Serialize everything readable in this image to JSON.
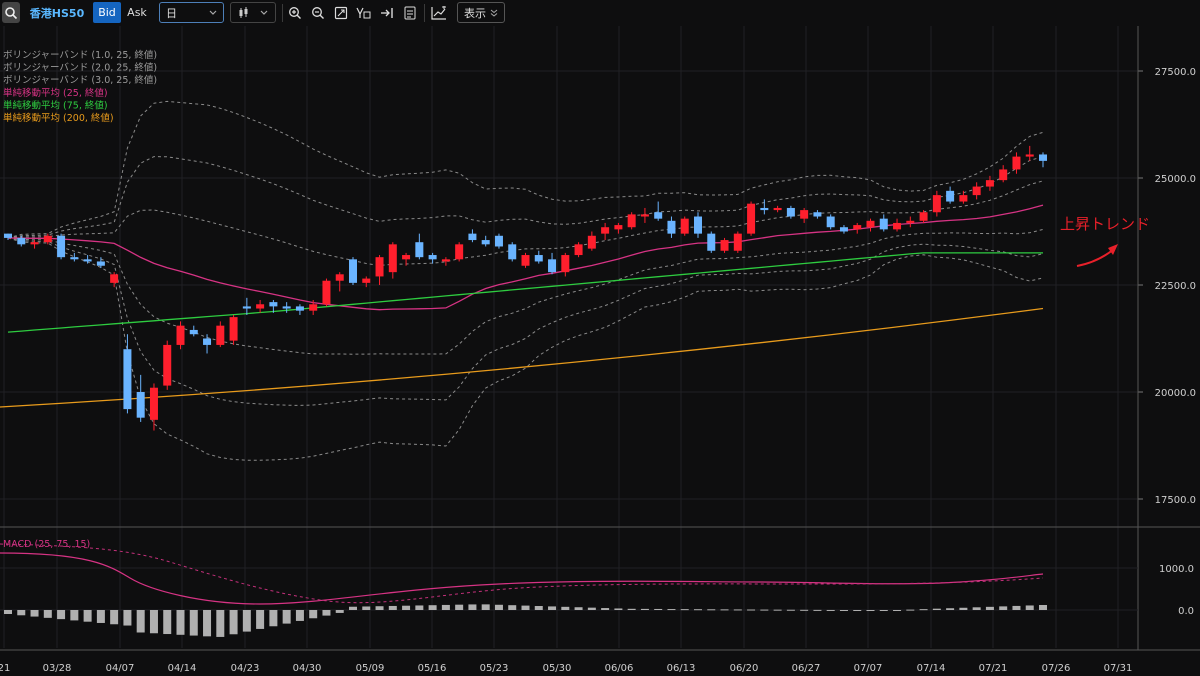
{
  "toolbar": {
    "symbol": "香港HS50",
    "bid": "Bid",
    "ask": "Ask",
    "timeframe": "日",
    "display": "表示",
    "accent": "#1565c0"
  },
  "legend": [
    {
      "label": "ボリンジャーバンド (1.0, 25, 終値)",
      "color": "#9a9a9a"
    },
    {
      "label": "ボリンジャーバンド (2.0, 25, 終値)",
      "color": "#9a9a9a"
    },
    {
      "label": "ボリンジャーバンド (3.0, 25, 終値)",
      "color": "#9a9a9a"
    },
    {
      "label": "単純移動平均 (25, 終値)",
      "color": "#d63384"
    },
    {
      "label": "単純移動平均 (75, 終値)",
      "color": "#2ecc40"
    },
    {
      "label": "単純移動平均 (200, 終値)",
      "color": "#e89b1c"
    }
  ],
  "annotation": {
    "text": "上昇トレンド",
    "color": "#e8202a"
  },
  "macd_label": "MACD (25, 75, 15)",
  "chart_data": {
    "type": "candlestick",
    "y_ticks": [
      "27500.0",
      "25000.0",
      "22500.0",
      "20000.0",
      "17500.0"
    ],
    "y_tick_values": [
      27500,
      25000,
      22500,
      20000,
      17500
    ],
    "ylim": [
      16900,
      28200
    ],
    "x_tick_labels": [
      "21",
      "03/28",
      "04/07",
      "04/14",
      "04/23",
      "04/30",
      "05/09",
      "05/16",
      "05/23",
      "05/30",
      "06/06",
      "06/13",
      "06/20",
      "06/27",
      "07/07",
      "07/14",
      "07/21",
      "07/26",
      "07/31"
    ],
    "up_color": "#ff1f2d",
    "down_color": "#6ab4ff",
    "candles": [
      [
        23700,
        23700,
        23550,
        23600
      ],
      [
        23600,
        23650,
        23400,
        23450
      ],
      [
        23450,
        23550,
        23350,
        23500
      ],
      [
        23500,
        23700,
        23450,
        23650
      ],
      [
        23650,
        23700,
        23100,
        23150
      ],
      [
        23150,
        23250,
        23050,
        23100
      ],
      [
        23100,
        23200,
        23000,
        23050
      ],
      [
        23050,
        23150,
        22900,
        22950
      ],
      [
        22550,
        22800,
        22450,
        22750
      ],
      [
        21000,
        21350,
        19500,
        19600
      ],
      [
        20000,
        20400,
        19300,
        19400
      ],
      [
        19350,
        20200,
        19100,
        20100
      ],
      [
        20150,
        21200,
        20050,
        21100
      ],
      [
        21100,
        21650,
        21000,
        21550
      ],
      [
        21450,
        21550,
        21300,
        21350
      ],
      [
        21250,
        21350,
        20900,
        21100
      ],
      [
        21100,
        21650,
        21050,
        21550
      ],
      [
        21200,
        21800,
        21100,
        21750
      ],
      [
        22000,
        22200,
        21800,
        21950
      ],
      [
        21950,
        22150,
        21850,
        22050
      ],
      [
        22100,
        22150,
        21850,
        22000
      ],
      [
        22000,
        22100,
        21850,
        21950
      ],
      [
        22000,
        22050,
        21800,
        21900
      ],
      [
        21900,
        22150,
        21800,
        22050
      ],
      [
        22050,
        22650,
        22000,
        22600
      ],
      [
        22600,
        22800,
        22350,
        22750
      ],
      [
        23100,
        23150,
        22500,
        22550
      ],
      [
        22550,
        22700,
        22450,
        22650
      ],
      [
        22700,
        23200,
        22500,
        23150
      ],
      [
        22800,
        23500,
        22650,
        23450
      ],
      [
        23100,
        23250,
        22950,
        23200
      ],
      [
        23500,
        23700,
        23100,
        23150
      ],
      [
        23200,
        23250,
        23000,
        23100
      ],
      [
        23050,
        23150,
        22950,
        23100
      ],
      [
        23100,
        23500,
        23050,
        23450
      ],
      [
        23700,
        23800,
        23500,
        23550
      ],
      [
        23550,
        23650,
        23400,
        23450
      ],
      [
        23650,
        23700,
        23350,
        23400
      ],
      [
        23450,
        23500,
        23050,
        23100
      ],
      [
        22950,
        23250,
        22900,
        23200
      ],
      [
        23200,
        23300,
        23000,
        23050
      ],
      [
        23100,
        23250,
        22750,
        22800
      ],
      [
        22800,
        23250,
        22700,
        23200
      ],
      [
        23200,
        23500,
        23150,
        23450
      ],
      [
        23350,
        23750,
        23300,
        23650
      ],
      [
        23700,
        23950,
        23550,
        23850
      ],
      [
        23800,
        23950,
        23700,
        23900
      ],
      [
        23850,
        24200,
        23800,
        24150
      ],
      [
        24100,
        24300,
        23950,
        24150
      ],
      [
        24200,
        24450,
        24000,
        24050
      ],
      [
        24000,
        24100,
        23600,
        23700
      ],
      [
        23700,
        24100,
        23650,
        24050
      ],
      [
        24100,
        24200,
        23600,
        23700
      ],
      [
        23700,
        23750,
        23250,
        23300
      ],
      [
        23300,
        23600,
        23250,
        23550
      ],
      [
        23300,
        23750,
        23250,
        23700
      ],
      [
        23700,
        24450,
        23650,
        24400
      ],
      [
        24300,
        24500,
        24150,
        24250
      ],
      [
        24250,
        24350,
        24200,
        24300
      ],
      [
        24300,
        24350,
        24050,
        24100
      ],
      [
        24050,
        24300,
        23950,
        24250
      ],
      [
        24200,
        24250,
        24050,
        24100
      ],
      [
        24100,
        24150,
        23800,
        23850
      ],
      [
        23850,
        23900,
        23700,
        23750
      ],
      [
        23800,
        23950,
        23700,
        23900
      ],
      [
        23850,
        24050,
        23750,
        24000
      ],
      [
        24050,
        24150,
        23750,
        23800
      ],
      [
        23800,
        24050,
        23750,
        23950
      ],
      [
        23950,
        24100,
        23850,
        24000
      ],
      [
        24000,
        24250,
        23950,
        24200
      ],
      [
        24200,
        24700,
        24100,
        24600
      ],
      [
        24700,
        24800,
        24400,
        24450
      ],
      [
        24450,
        24700,
        24400,
        24600
      ],
      [
        24600,
        24900,
        24500,
        24800
      ],
      [
        24800,
        25050,
        24700,
        24950
      ],
      [
        24950,
        25300,
        24900,
        25200
      ],
      [
        25200,
        25600,
        25100,
        25500
      ],
      [
        25500,
        25750,
        25400,
        25550
      ],
      [
        25550,
        25600,
        25250,
        25400
      ]
    ]
  }
}
